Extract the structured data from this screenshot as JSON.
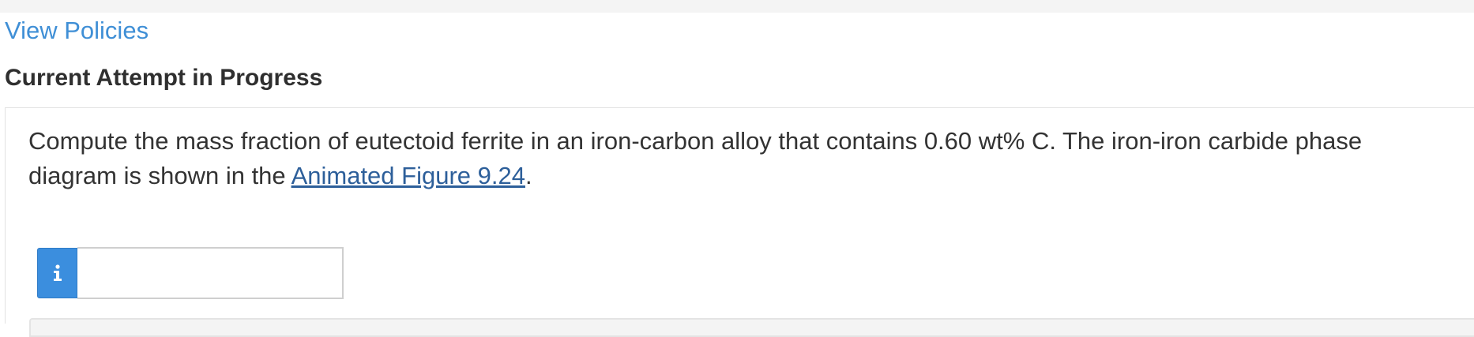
{
  "header": {
    "policies_link": "View Policies",
    "attempt_title": "Current Attempt in Progress"
  },
  "question": {
    "text_before_link": "Compute the mass fraction of eutectoid ferrite in an iron-carbon alloy that contains 0.60 wt% C. The iron-iron carbide phase diagram is shown in the ",
    "link_text": "Animated Figure 9.24",
    "text_after_link": "."
  },
  "answer": {
    "info_icon": "info-icon",
    "value": "",
    "accent_color": "#3b8ede"
  },
  "colors": {
    "link": "#3f8fd6",
    "title": "#2f2f2f",
    "figure_link": "#2d5f9a"
  }
}
